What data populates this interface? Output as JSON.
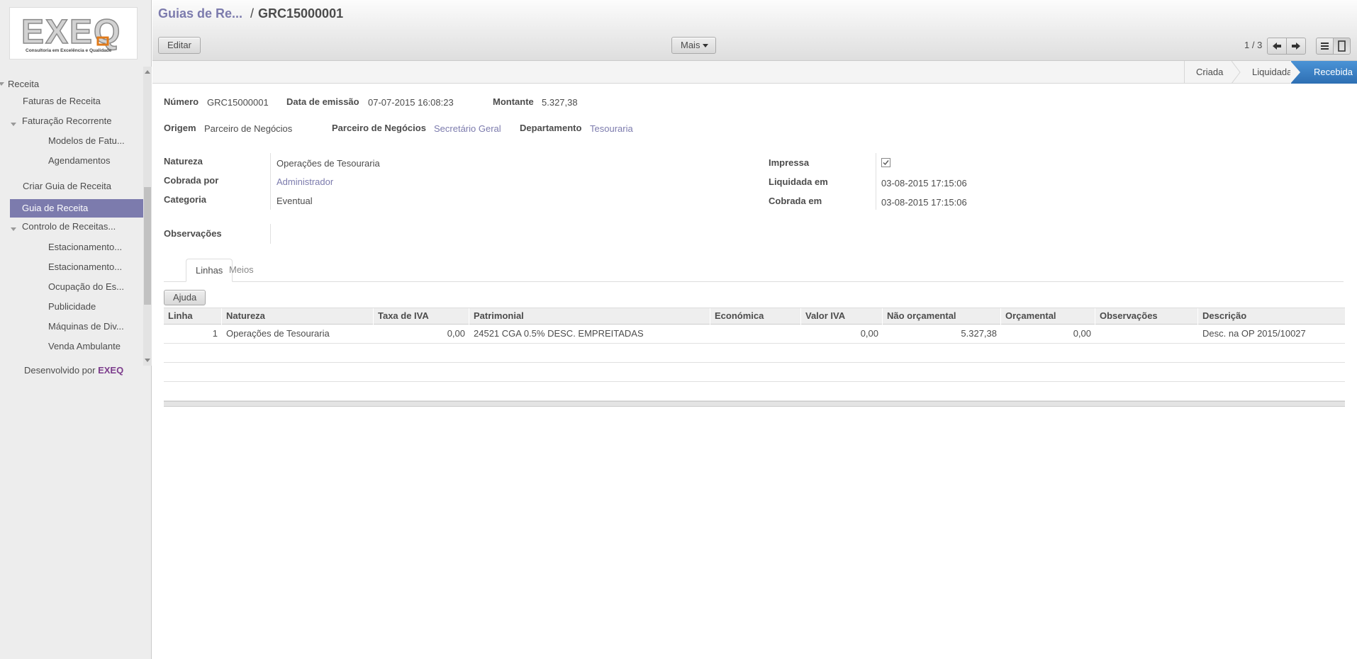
{
  "sidebar": {
    "logo_text": "EXEQ",
    "logo_tagline": "Consultoria em Excelência e Qualidade",
    "menu": {
      "receita": "Receita",
      "faturas_de_receita": "Faturas de Receita",
      "faturacao_recorrente": "Faturação Recorrente",
      "modelos_de_fatu": "Modelos de Fatu...",
      "agendamentos": "Agendamentos",
      "criar_guia_de_receita": "Criar Guia de Receita",
      "guia_de_receita": "Guia de Receita",
      "controlo_de_receitas": "Controlo de Receitas...",
      "estacionamento_1": "Estacionamento...",
      "estacionamento_2": "Estacionamento...",
      "ocupacao_do_es": "Ocupação do Es...",
      "publicidade": "Publicidade",
      "maquinas_de_div": "Máquinas de Div...",
      "venda_ambulante": "Venda Ambulante"
    },
    "powered_prefix": "Desenvolvido por ",
    "powered_brand": "EXEQ"
  },
  "header": {
    "breadcrumb_parent": "Guias de Re...",
    "breadcrumb_separator": "/",
    "breadcrumb_current": "GRC15000001",
    "edit_button": "Editar",
    "more_button": "Mais",
    "pager": "1 / 3"
  },
  "status": {
    "stages": [
      "Criada",
      "Liquidada",
      "Recebida"
    ],
    "current": "Recebida"
  },
  "form": {
    "numero_label": "Número",
    "numero": "GRC15000001",
    "data_emissao_label": "Data de emissão",
    "data_emissao": "07-07-2015 16:08:23",
    "montante_label": "Montante",
    "montante": "5.327,38",
    "origem_label": "Origem",
    "origem": "Parceiro de Negócios",
    "parceiro_label": "Parceiro de Negócios",
    "parceiro": "Secretário Geral",
    "departamento_label": "Departamento",
    "departamento": "Tesouraria",
    "natureza_label": "Natureza",
    "natureza": "Operações de Tesouraria",
    "cobrada_por_label": "Cobrada por",
    "cobrada_por": "Administrador",
    "categoria_label": "Categoria",
    "categoria": "Eventual",
    "impressa_label": "Impressa",
    "impressa": true,
    "liquidada_em_label": "Liquidada em",
    "liquidada_em": "03-08-2015 17:15:06",
    "cobrada_em_label": "Cobrada em",
    "cobrada_em": "03-08-2015 17:15:06",
    "observacoes_label": "Observações",
    "observacoes": ""
  },
  "tabs": [
    "Linhas",
    "Meios"
  ],
  "lines": {
    "help_button": "Ajuda",
    "columns": [
      "Linha",
      "Natureza",
      "Taxa de IVA",
      "Patrimonial",
      "Económica",
      "Valor IVA",
      "Não orçamental",
      "Orçamental",
      "Observações",
      "Descrição"
    ],
    "rows": [
      {
        "linha": "1",
        "natureza": "Operações de Tesouraria",
        "taxa_iva": "0,00",
        "patrimonial": "24521 CGA 0.5% DESC. EMPREITADAS",
        "economica": "",
        "valor_iva": "0,00",
        "nao_orcamental": "5.327,38",
        "orcamental": "0,00",
        "observacoes": "",
        "descricao": "Desc. na OP 2015/10027"
      }
    ]
  }
}
